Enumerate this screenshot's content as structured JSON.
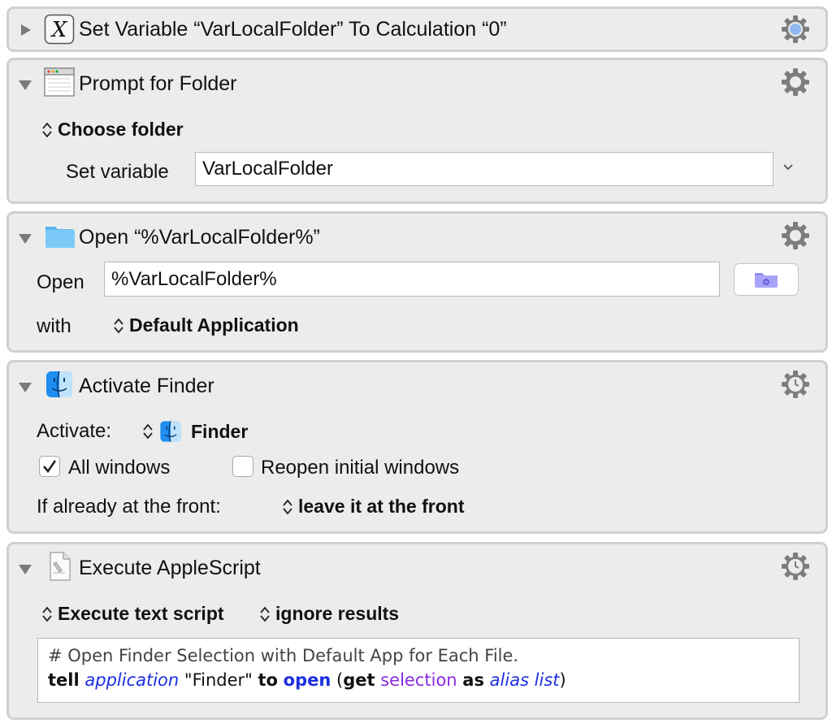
{
  "actions": {
    "set_variable": {
      "title": "Set Variable “VarLocalFolder” To Calculation “0”"
    },
    "prompt_folder": {
      "title": "Prompt for Folder",
      "mode": "Choose folder",
      "set_variable_label": "Set variable",
      "variable_value": "VarLocalFolder"
    },
    "open_folder": {
      "title": "Open “%VarLocalFolder%”",
      "open_label": "Open",
      "open_value": "%VarLocalFolder%",
      "with_label": "with",
      "app_value": "Default Application"
    },
    "activate_finder": {
      "title": "Activate Finder",
      "activate_label": "Activate:",
      "app_value": "Finder",
      "all_windows_label": "All windows",
      "all_windows_checked": true,
      "reopen_label": "Reopen initial windows",
      "reopen_checked": false,
      "front_label": "If already at the front:",
      "front_value": "leave it at the front"
    },
    "execute_applescript": {
      "title": "Execute AppleScript",
      "mode": "Execute text script",
      "results": "ignore results",
      "script": {
        "comment": "# Open Finder Selection with Default App for Each File.",
        "t_tell": "tell",
        "t_application": "application",
        "t_finder": "\"Finder\"",
        "t_to": "to",
        "t_open": "open",
        "t_paren_open": "(",
        "t_get": "get",
        "t_selection": "selection",
        "t_as": "as",
        "t_alias_list": "alias list",
        "t_paren_close": ")"
      }
    }
  },
  "colors": {
    "panel_bg": "#ececec",
    "panel_border": "#d0d0d0",
    "keyword_blue": "#1c2fe0",
    "property_purple": "#8a2be2"
  },
  "icons": {
    "variable": "x-variable-icon",
    "window": "window-icon",
    "folder": "folder-icon",
    "finder": "finder-icon",
    "script": "applescript-icon",
    "gear": "gear-icon",
    "clock_gear": "clock-gear-icon"
  }
}
